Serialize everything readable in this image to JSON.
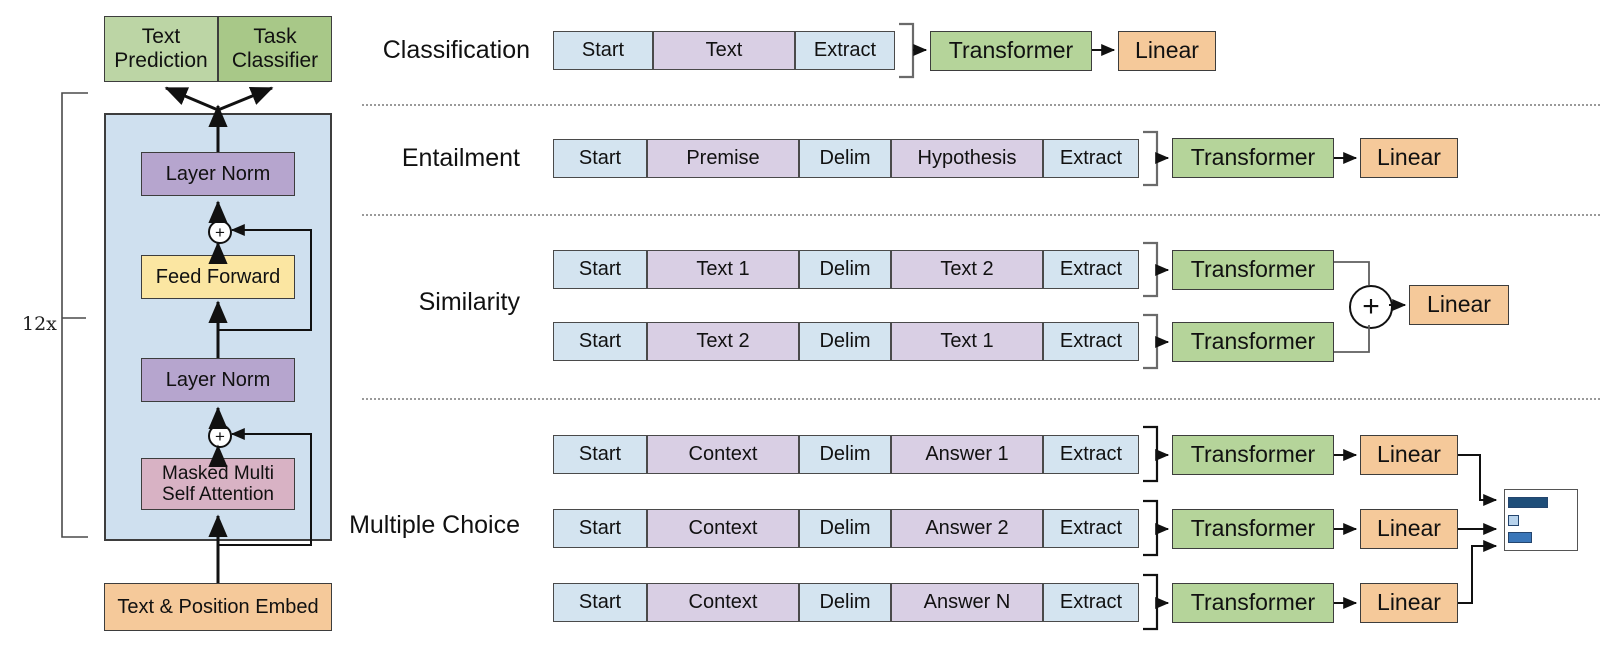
{
  "figure": {
    "title": "GPT transformer architecture and input transformations for fine-tuning on different tasks",
    "repeat_label": "12x"
  },
  "colors": {
    "token_blue": "#d4e4f0",
    "token_purple": "#d9cfe4",
    "transformer_green": "#b5d49a",
    "linear_orange": "#f5c99a",
    "layer_norm_purple": "#b6a5ce",
    "feed_forward_yellow": "#fbe6a2",
    "attention_pink": "#d8b2c4",
    "block_background_blue": "#cfe0ef",
    "text_prediction_green": "#bcd5a5",
    "task_classifier_green": "#a8c888",
    "softmax_bar_dark": "#1f4e79",
    "softmax_bar_mid": "#3a76b8",
    "softmax_bar_light": "#b8d3ec"
  },
  "left_panel": {
    "heads": [
      {
        "label": "Text Prediction",
        "name": "text-prediction-head"
      },
      {
        "label": "Task Classifier",
        "name": "task-classifier-head"
      }
    ],
    "repeat_label": "12x",
    "blocks": [
      {
        "label": "Layer Norm",
        "name": "layer-norm-top"
      },
      {
        "label": "Feed Forward",
        "name": "feed-forward"
      },
      {
        "label": "Layer Norm",
        "name": "layer-norm-bottom"
      },
      {
        "label": "Masked Multi Self Attention",
        "line1": "Masked Multi",
        "line2": "Self Attention",
        "name": "masked-multi-self-attention"
      }
    ],
    "embed": {
      "label": "Text & Position Embed",
      "name": "text-position-embed"
    },
    "residual_symbol": "+"
  },
  "tasks": [
    {
      "name": "classification",
      "label": "Classification",
      "rows": [
        {
          "tokens": [
            {
              "text": "Start",
              "kind": "blue"
            },
            {
              "text": "Text",
              "kind": "purple"
            },
            {
              "text": "Extract",
              "kind": "blue"
            }
          ],
          "transformer": "Transformer",
          "linear": "Linear"
        }
      ]
    },
    {
      "name": "entailment",
      "label": "Entailment",
      "rows": [
        {
          "tokens": [
            {
              "text": "Start",
              "kind": "blue"
            },
            {
              "text": "Premise",
              "kind": "purple"
            },
            {
              "text": "Delim",
              "kind": "blue"
            },
            {
              "text": "Hypothesis",
              "kind": "purple"
            },
            {
              "text": "Extract",
              "kind": "blue"
            }
          ],
          "transformer": "Transformer",
          "linear": "Linear"
        }
      ]
    },
    {
      "name": "similarity",
      "label": "Similarity",
      "merge_symbol": "+",
      "linear": "Linear",
      "rows": [
        {
          "tokens": [
            {
              "text": "Start",
              "kind": "blue"
            },
            {
              "text": "Text 1",
              "kind": "purple"
            },
            {
              "text": "Delim",
              "kind": "blue"
            },
            {
              "text": "Text 2",
              "kind": "purple"
            },
            {
              "text": "Extract",
              "kind": "blue"
            }
          ],
          "transformer": "Transformer"
        },
        {
          "tokens": [
            {
              "text": "Start",
              "kind": "blue"
            },
            {
              "text": "Text 2",
              "kind": "purple"
            },
            {
              "text": "Delim",
              "kind": "blue"
            },
            {
              "text": "Text 1",
              "kind": "purple"
            },
            {
              "text": "Extract",
              "kind": "blue"
            }
          ],
          "transformer": "Transformer"
        }
      ]
    },
    {
      "name": "multiple-choice",
      "label": "Multiple Choice",
      "rows": [
        {
          "tokens": [
            {
              "text": "Start",
              "kind": "blue"
            },
            {
              "text": "Context",
              "kind": "purple"
            },
            {
              "text": "Delim",
              "kind": "blue"
            },
            {
              "text": "Answer 1",
              "kind": "purple"
            },
            {
              "text": "Extract",
              "kind": "blue"
            }
          ],
          "transformer": "Transformer",
          "linear": "Linear"
        },
        {
          "tokens": [
            {
              "text": "Start",
              "kind": "blue"
            },
            {
              "text": "Context",
              "kind": "purple"
            },
            {
              "text": "Delim",
              "kind": "blue"
            },
            {
              "text": "Answer 2",
              "kind": "purple"
            },
            {
              "text": "Extract",
              "kind": "blue"
            }
          ],
          "transformer": "Transformer",
          "linear": "Linear"
        },
        {
          "tokens": [
            {
              "text": "Start",
              "kind": "blue"
            },
            {
              "text": "Context",
              "kind": "purple"
            },
            {
              "text": "Delim",
              "kind": "blue"
            },
            {
              "text": "Answer N",
              "kind": "purple"
            },
            {
              "text": "Extract",
              "kind": "blue"
            }
          ],
          "transformer": "Transformer",
          "linear": "Linear"
        }
      ],
      "softmax": {
        "name": "softmax-bar-chart",
        "bars": [
          {
            "value": 0.72,
            "color": "#1f4e79"
          },
          {
            "value": 0.1,
            "color": "#b8d3ec"
          },
          {
            "value": 0.34,
            "color": "#3a76b8"
          }
        ]
      }
    }
  ]
}
